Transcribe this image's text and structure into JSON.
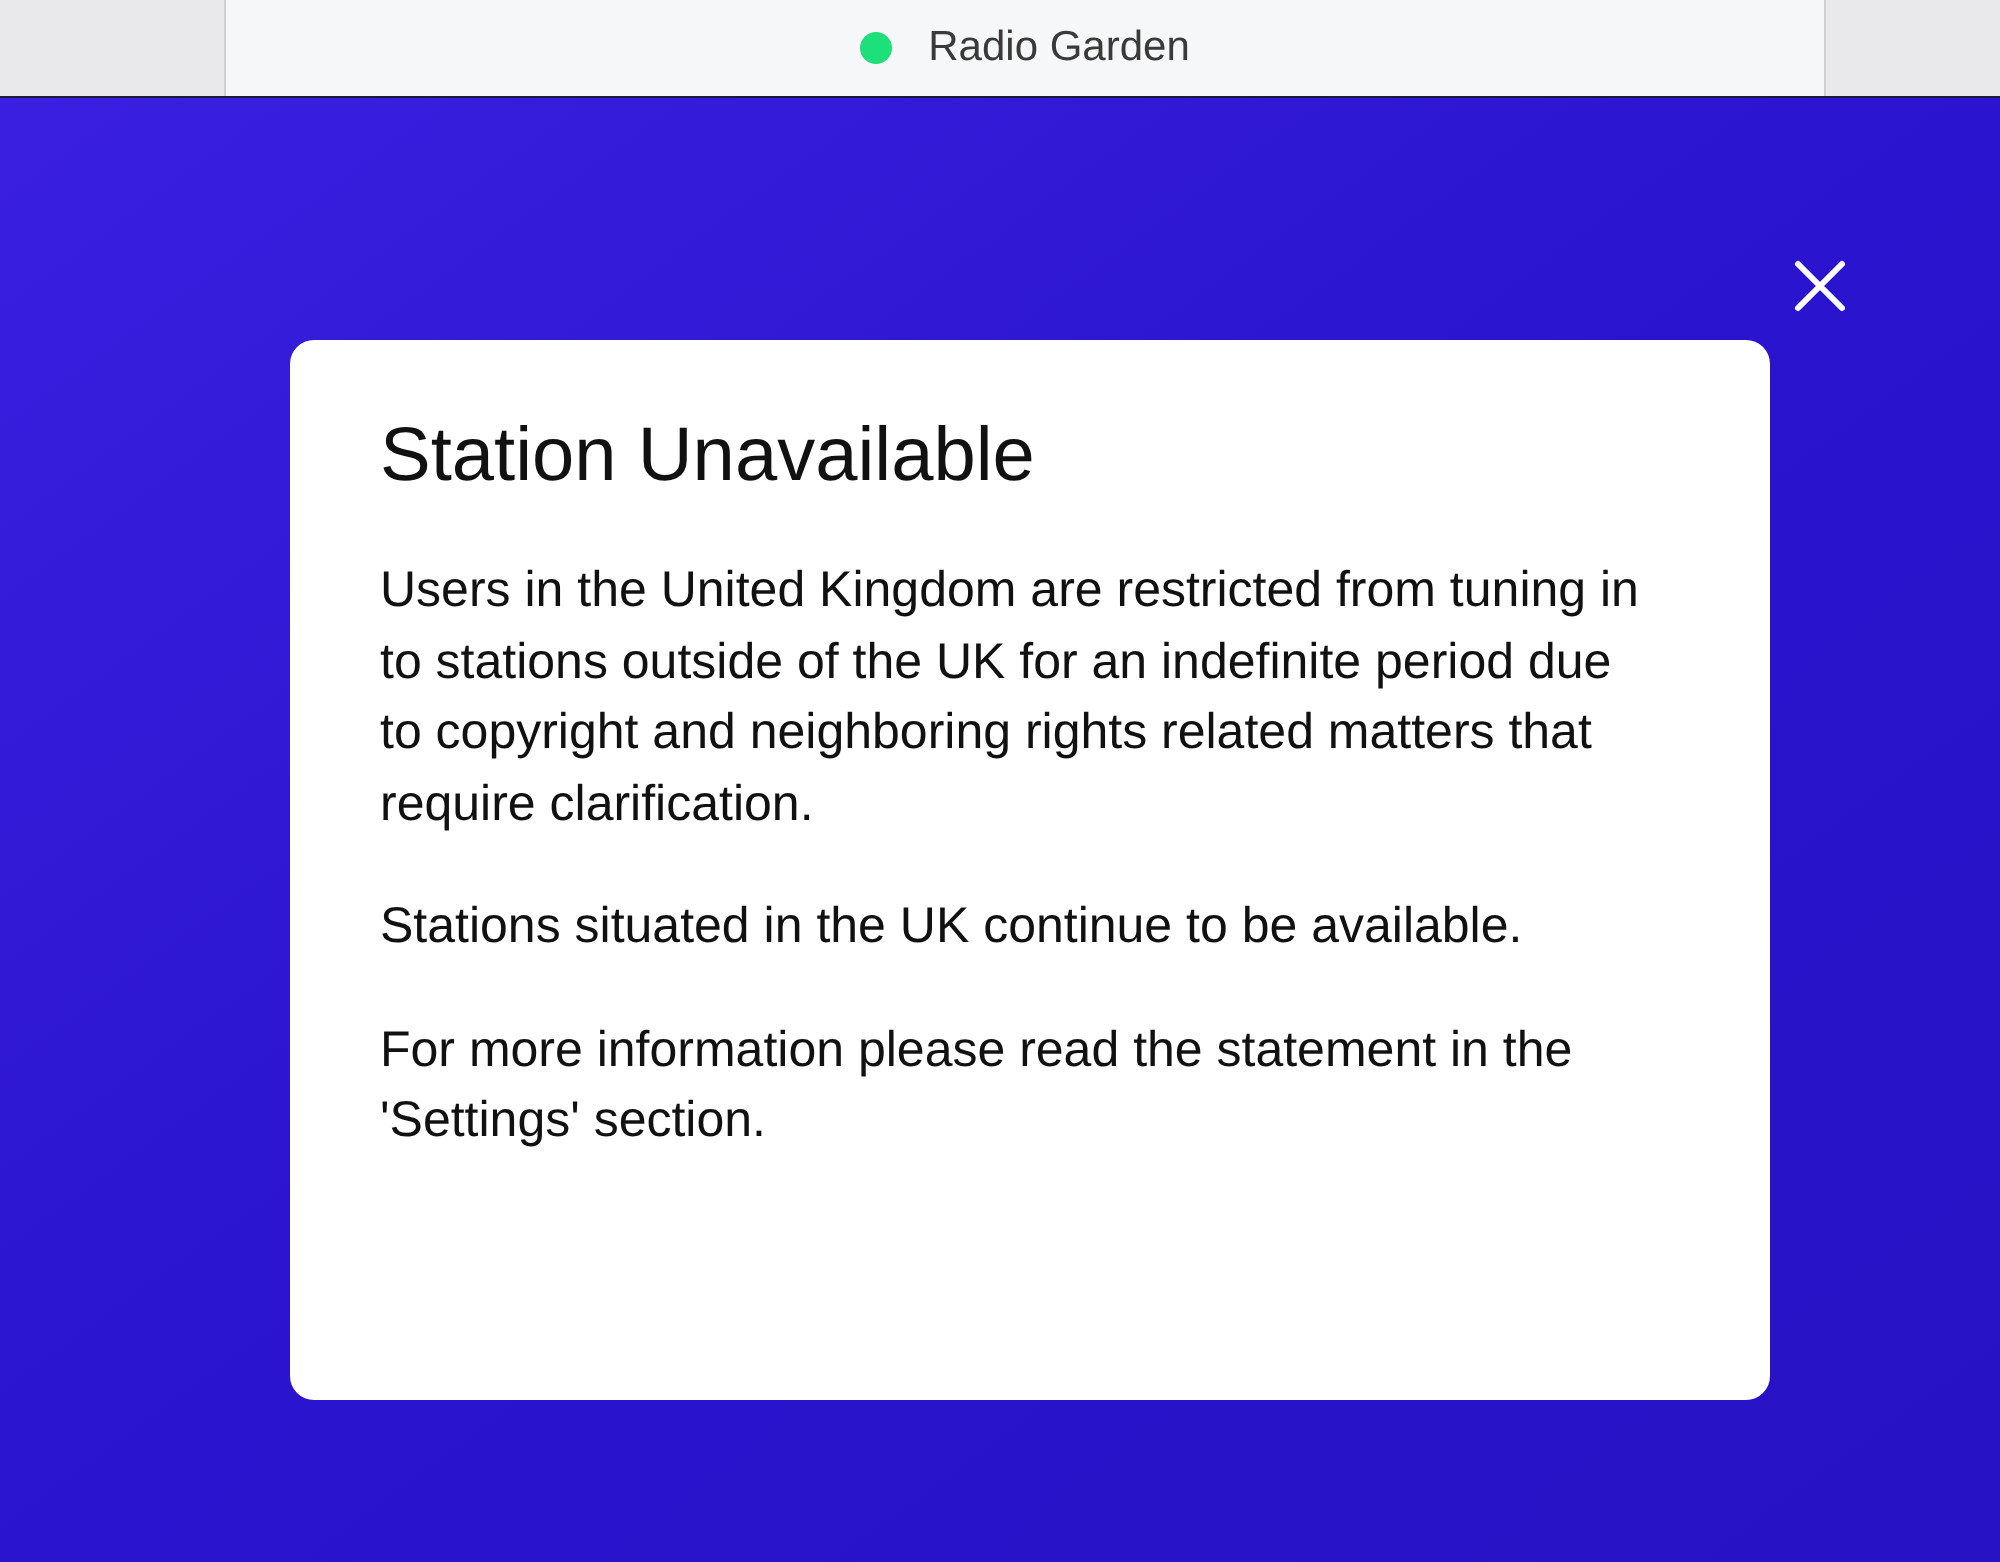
{
  "tab": {
    "title": "Radio Garden"
  },
  "dialog": {
    "title": "Station Unavailable",
    "paragraphs": [
      "Users in the United Kingdom are restricted from tuning in to stations outside of the UK for an indefinite period due to copyright and neighboring rights related matters that require clarification.",
      "Stations situated in the UK continue to be available.",
      "For more information please read the statement in the 'Settings' section."
    ]
  }
}
